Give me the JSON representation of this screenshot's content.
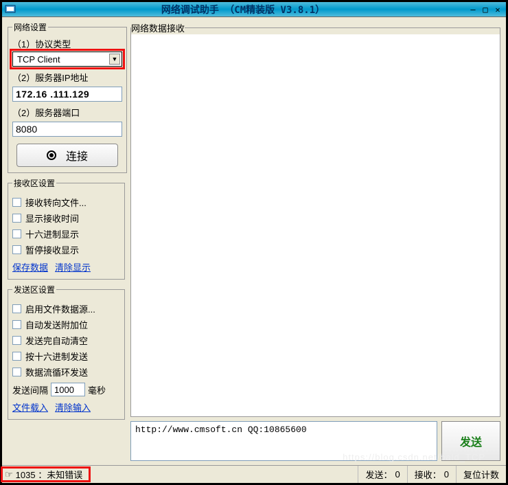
{
  "window": {
    "title": "网络调试助手 （CM精装版 V3.8.1）"
  },
  "net_settings": {
    "legend": "网络设置",
    "protocol_label": "（1）协议类型",
    "protocol_value": "TCP Client",
    "ip_label": "（2）服务器IP地址",
    "ip_value": "172.16 .111.129",
    "port_label": "（2）服务器端口",
    "port_value": "8080",
    "connect_label": "连接"
  },
  "recv_settings": {
    "legend": "接收区设置",
    "items": [
      "接收转向文件...",
      "显示接收时间",
      "十六进制显示",
      "暂停接收显示"
    ],
    "link_save": "保存数据",
    "link_clear": "清除显示"
  },
  "send_settings": {
    "legend": "发送区设置",
    "items": [
      "启用文件数据源...",
      "自动发送附加位",
      "发送完自动清空",
      "按十六进制发送",
      "数据流循环发送"
    ],
    "interval_prefix": "发送间隔",
    "interval_value": "1000",
    "interval_suffix": "毫秒",
    "link_load": "文件载入",
    "link_clear": "清除输入"
  },
  "recv_area": {
    "legend": "网络数据接收"
  },
  "send_area": {
    "text": "http://www.cmsoft.cn QQ:10865600",
    "button": "发送"
  },
  "status": {
    "left": "1035 ：未知错误",
    "send_label": "发送：",
    "send_count": "0",
    "recv_label": "接收：",
    "recv_count": "0",
    "reset": "复位计数"
  },
  "watermark": "https://blog.csdn.net/bald_TCP"
}
